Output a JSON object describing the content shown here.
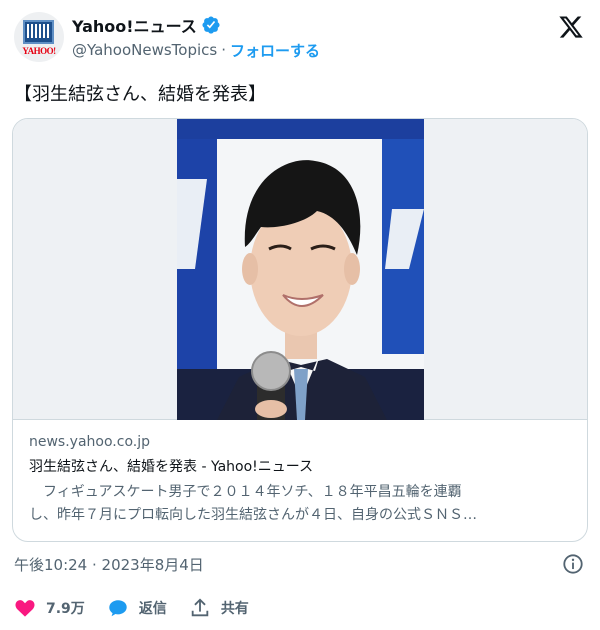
{
  "colors": {
    "accent": "#1d9bf0",
    "like": "#f91880",
    "text": "#0f1419",
    "muted": "#536471",
    "border": "#cfd9de"
  },
  "author": {
    "display_name": "Yahoo!ニュース",
    "handle": "@YahooNewsTopics",
    "separator": "·",
    "follow_label": "フォローする",
    "avatar_text": "YAHOO!",
    "verified_icon": "verified-badge-icon"
  },
  "tweet": {
    "text": "【羽生結弦さん、結婚を発表】"
  },
  "card": {
    "domain": "news.yahoo.co.jp",
    "title": "羽生結弦さん、結婚を発表 - Yahoo!ニュース",
    "description": "　フィギュアスケート男子で２０１４年ソチ、１８年平昌五輪を連覇\nし、昨年７月にプロ転向した羽生結弦さんが４日、自身の公式ＳＮＳ…"
  },
  "meta": {
    "timestamp": "午後10:24 · 2023年8月4日",
    "info_icon": "info-icon"
  },
  "actions": {
    "like_count": "7.9万",
    "reply_label": "返信",
    "share_label": "共有"
  }
}
